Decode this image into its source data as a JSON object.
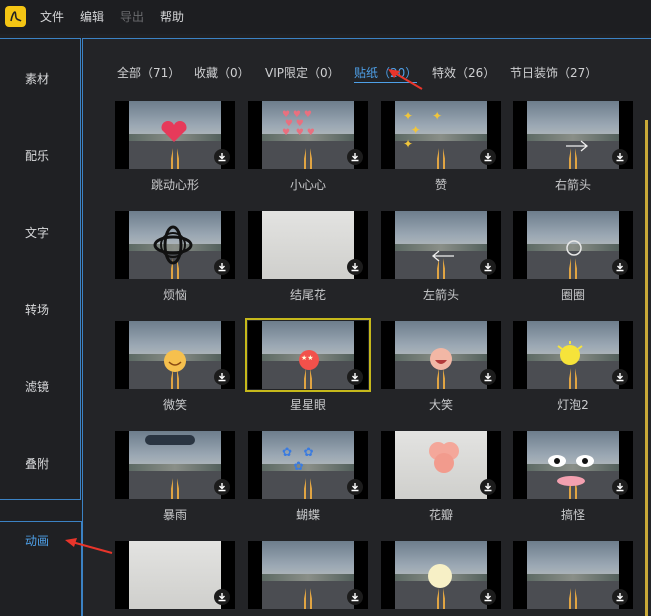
{
  "menu": {
    "file": "文件",
    "edit": "编辑",
    "export": "导出",
    "help": "帮助"
  },
  "sidebar": {
    "items": [
      {
        "label": "素材"
      },
      {
        "label": "配乐"
      },
      {
        "label": "文字"
      },
      {
        "label": "转场"
      },
      {
        "label": "滤镜"
      },
      {
        "label": "叠附"
      },
      {
        "label": "动画"
      }
    ],
    "active_index": 6
  },
  "tabs": [
    {
      "label": "全部（71）"
    },
    {
      "label": "收藏（0）"
    },
    {
      "label": "VIP限定（0）"
    },
    {
      "label": "贴纸（20）"
    },
    {
      "label": "特效（26）"
    },
    {
      "label": "节日装饰（27）"
    }
  ],
  "active_tab": 3,
  "stickers": [
    {
      "name": "跳动心形"
    },
    {
      "name": "小心心"
    },
    {
      "name": "赞"
    },
    {
      "name": "右箭头"
    },
    {
      "name": "烦恼"
    },
    {
      "name": "结尾花"
    },
    {
      "name": "左箭头"
    },
    {
      "name": "圈圈"
    },
    {
      "name": "微笑"
    },
    {
      "name": "星星眼"
    },
    {
      "name": "大笑"
    },
    {
      "name": "灯泡2"
    },
    {
      "name": "暴雨"
    },
    {
      "name": "蝴蝶"
    },
    {
      "name": "花瓣"
    },
    {
      "name": "搞怪"
    },
    {
      "name": ""
    },
    {
      "name": ""
    },
    {
      "name": ""
    },
    {
      "name": ""
    }
  ],
  "selected_sticker": "星星眼",
  "colors": {
    "accent": "#4ea0e8",
    "selection": "#c6b91b",
    "logo": "#f4c514",
    "annotation_arrow": "#e8352b"
  }
}
